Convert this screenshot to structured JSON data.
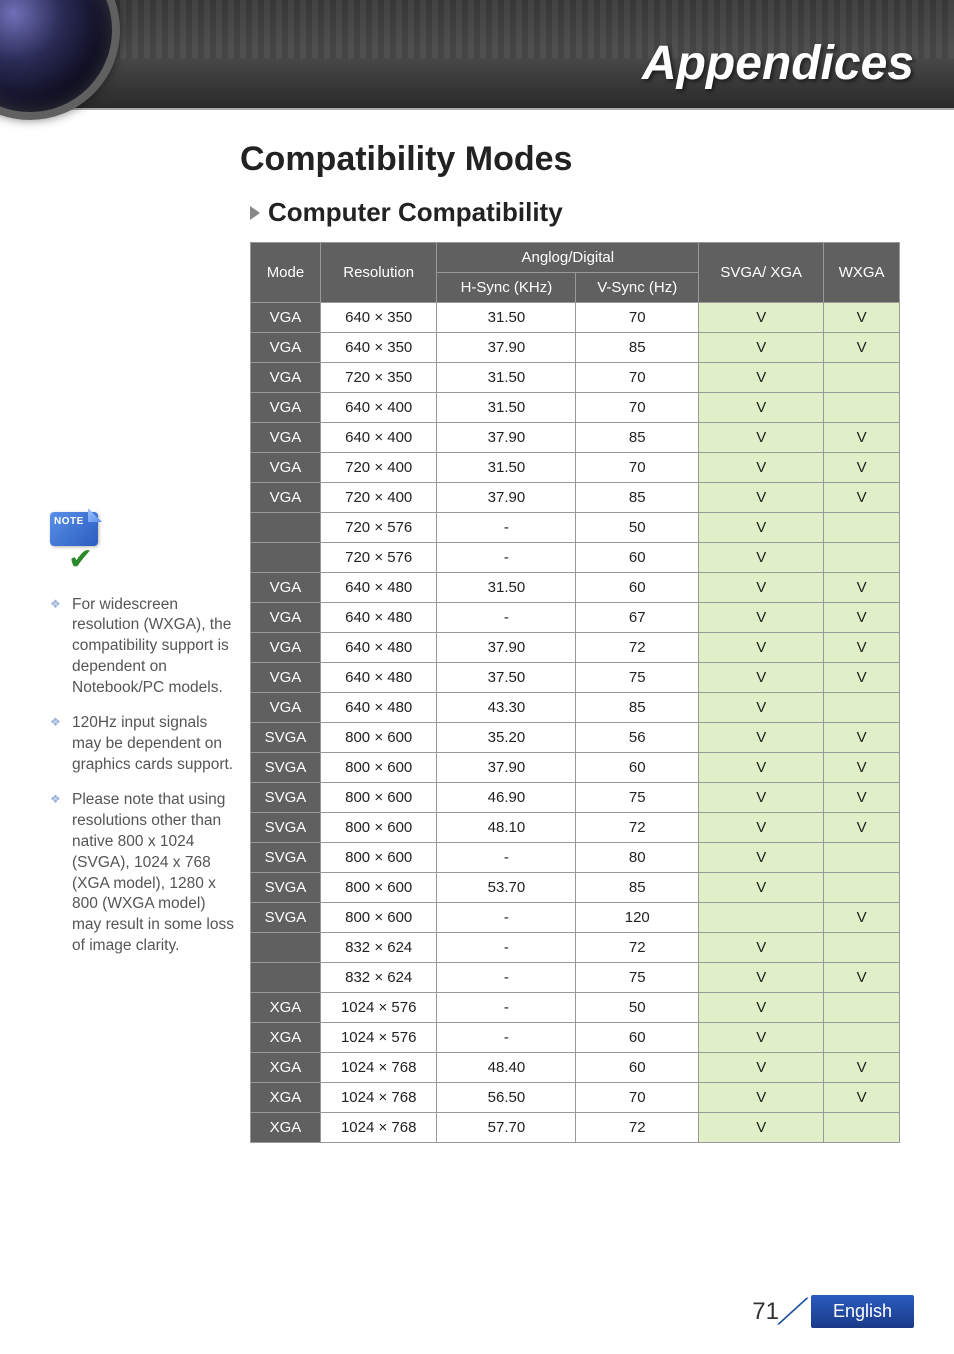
{
  "header": {
    "title": "Appendices"
  },
  "page": {
    "h1": "Compatibility Modes",
    "h2": "Computer Compatibility"
  },
  "table": {
    "headers": {
      "mode": "Mode",
      "resolution": "Resolution",
      "analog_digital": "Anglog/Digital",
      "hsync": "H-Sync (KHz)",
      "vsync": "V-Sync (Hz)",
      "svga_xga": "SVGA/ XGA",
      "wxga": "WXGA"
    },
    "rows": [
      {
        "mode": "VGA",
        "res": "640 × 350",
        "h": "31.50",
        "v": "70",
        "s": "V",
        "w": "V"
      },
      {
        "mode": "VGA",
        "res": "640 × 350",
        "h": "37.90",
        "v": "85",
        "s": "V",
        "w": "V"
      },
      {
        "mode": "VGA",
        "res": "720 × 350",
        "h": "31.50",
        "v": "70",
        "s": "V",
        "w": ""
      },
      {
        "mode": "VGA",
        "res": "640 × 400",
        "h": "31.50",
        "v": "70",
        "s": "V",
        "w": ""
      },
      {
        "mode": "VGA",
        "res": "640 × 400",
        "h": "37.90",
        "v": "85",
        "s": "V",
        "w": "V"
      },
      {
        "mode": "VGA",
        "res": "720 × 400",
        "h": "31.50",
        "v": "70",
        "s": "V",
        "w": "V"
      },
      {
        "mode": "VGA",
        "res": "720 × 400",
        "h": "37.90",
        "v": "85",
        "s": "V",
        "w": "V"
      },
      {
        "mode": "",
        "res": "720 × 576",
        "h": "-",
        "v": "50",
        "s": "V",
        "w": ""
      },
      {
        "mode": "",
        "res": "720 × 576",
        "h": "-",
        "v": "60",
        "s": "V",
        "w": ""
      },
      {
        "mode": "VGA",
        "res": "640 × 480",
        "h": "31.50",
        "v": "60",
        "s": "V",
        "w": "V"
      },
      {
        "mode": "VGA",
        "res": "640 × 480",
        "h": "-",
        "v": "67",
        "s": "V",
        "w": "V"
      },
      {
        "mode": "VGA",
        "res": "640 × 480",
        "h": "37.90",
        "v": "72",
        "s": "V",
        "w": "V"
      },
      {
        "mode": "VGA",
        "res": "640 × 480",
        "h": "37.50",
        "v": "75",
        "s": "V",
        "w": "V"
      },
      {
        "mode": "VGA",
        "res": "640 × 480",
        "h": "43.30",
        "v": "85",
        "s": "V",
        "w": ""
      },
      {
        "mode": "SVGA",
        "res": "800 × 600",
        "h": "35.20",
        "v": "56",
        "s": "V",
        "w": "V"
      },
      {
        "mode": "SVGA",
        "res": "800 × 600",
        "h": "37.90",
        "v": "60",
        "s": "V",
        "w": "V"
      },
      {
        "mode": "SVGA",
        "res": "800 × 600",
        "h": "46.90",
        "v": "75",
        "s": "V",
        "w": "V"
      },
      {
        "mode": "SVGA",
        "res": "800 × 600",
        "h": "48.10",
        "v": "72",
        "s": "V",
        "w": "V"
      },
      {
        "mode": "SVGA",
        "res": "800 × 600",
        "h": "-",
        "v": "80",
        "s": "V",
        "w": ""
      },
      {
        "mode": "SVGA",
        "res": "800 × 600",
        "h": "53.70",
        "v": "85",
        "s": "V",
        "w": ""
      },
      {
        "mode": "SVGA",
        "res": "800 × 600",
        "h": "-",
        "v": "120",
        "s": "",
        "w": "V"
      },
      {
        "mode": "",
        "res": "832 × 624",
        "h": "-",
        "v": "72",
        "s": "V",
        "w": ""
      },
      {
        "mode": "",
        "res": "832 × 624",
        "h": "-",
        "v": "75",
        "s": "V",
        "w": "V"
      },
      {
        "mode": "XGA",
        "res": "1024 × 576",
        "h": "-",
        "v": "50",
        "s": "V",
        "w": ""
      },
      {
        "mode": "XGA",
        "res": "1024 × 576",
        "h": "-",
        "v": "60",
        "s": "V",
        "w": ""
      },
      {
        "mode": "XGA",
        "res": "1024 × 768",
        "h": "48.40",
        "v": "60",
        "s": "V",
        "w": "V"
      },
      {
        "mode": "XGA",
        "res": "1024 × 768",
        "h": "56.50",
        "v": "70",
        "s": "V",
        "w": "V"
      },
      {
        "mode": "XGA",
        "res": "1024 × 768",
        "h": "57.70",
        "v": "72",
        "s": "V",
        "w": ""
      }
    ]
  },
  "sidebar": {
    "note_label": "NOTE",
    "items": [
      "For widescreen resolution (WXGA), the compatibility support is dependent on Notebook/PC models.",
      "120Hz input signals may be dependent on graphics cards support.",
      "Please note that using resolu­tions other than native 800 x 1024 (SVGA), 1024 x 768 (XGA model), 1280 x 800 (WXGA model) may result in some loss of image clarity."
    ]
  },
  "footer": {
    "page": "71",
    "language": "English"
  }
}
